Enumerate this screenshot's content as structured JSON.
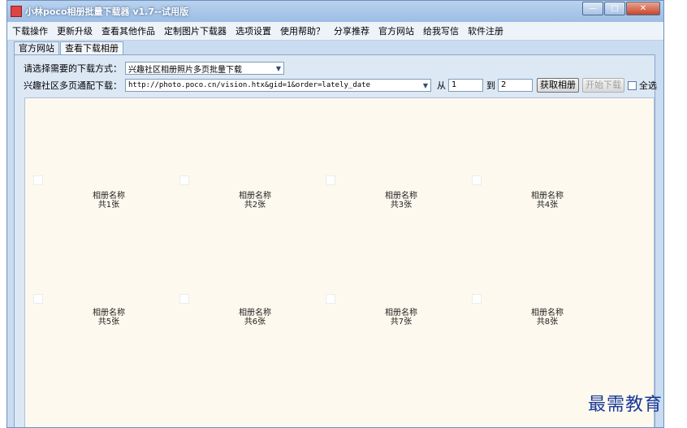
{
  "window": {
    "title": "小林poco相册批量下载器 v1.7--试用版",
    "buttons": [
      "—",
      "□",
      "✕"
    ]
  },
  "menu": [
    "下载操作",
    "更新升级",
    "查看其他作品",
    "定制图片下载器",
    "选项设置",
    "使用帮助？",
    "分享推荐",
    "官方网站",
    "给我写信",
    "软件注册"
  ],
  "tabs": [
    {
      "label": "官方网站",
      "active": false
    },
    {
      "label": "查看下载相册",
      "active": true
    }
  ],
  "form": {
    "mode_label": "请选择需要的下载方式：",
    "mode_value": "兴趣社区相册照片多页批量下载",
    "url_label": "兴趣社区多页通配下载：",
    "url_value": "http://photo.poco.cn/vision.htx&gid=1&order=lately_date",
    "from_label": "从",
    "from_value": "1",
    "to_label": "到",
    "to_value": "2",
    "fetch_button": "获取相册",
    "start_button": "开始下载",
    "select_all": "全选"
  },
  "albums": [
    {
      "name": "相册名称",
      "count": "共1张"
    },
    {
      "name": "相册名称",
      "count": "共2张"
    },
    {
      "name": "相册名称",
      "count": "共3张"
    },
    {
      "name": "相册名称",
      "count": "共4张"
    },
    {
      "name": "相册名称",
      "count": "共5张"
    },
    {
      "name": "相册名称",
      "count": "共6张"
    },
    {
      "name": "相册名称",
      "count": "共7张"
    },
    {
      "name": "相册名称",
      "count": "共8张"
    }
  ],
  "watermark": "最需教育"
}
